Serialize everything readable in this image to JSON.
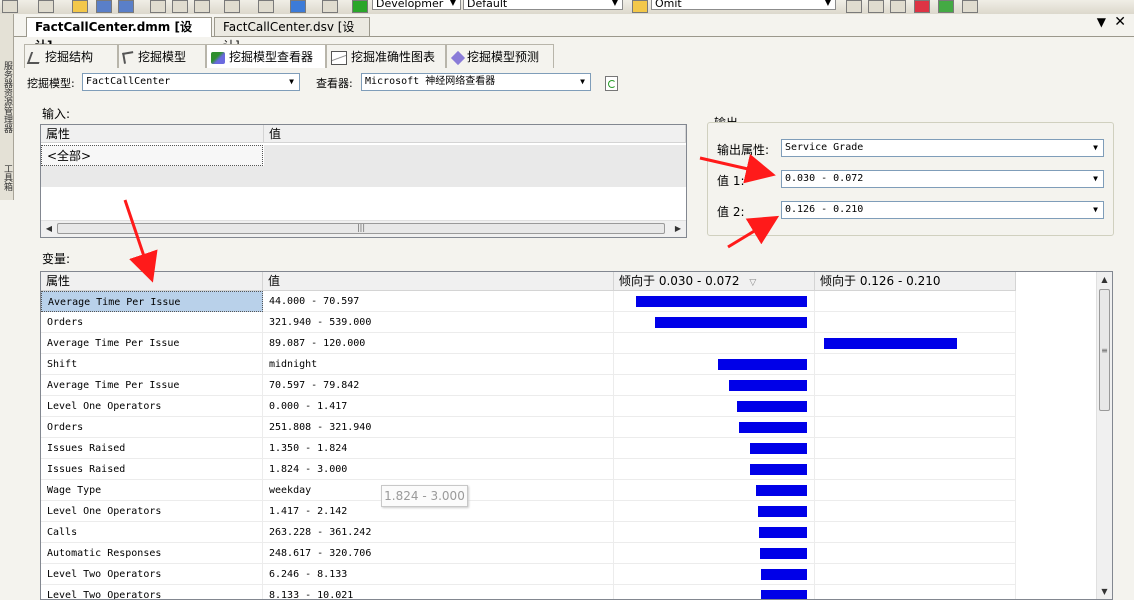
{
  "toolbar": {
    "config_value": "Developmer",
    "platform_value": "Default",
    "find_value": "Omit"
  },
  "left_strip": {
    "server_explorer": "服务器资源管理器",
    "toolbox": "工具箱"
  },
  "doc_tabs": [
    {
      "label": "FactCallCenter.dmm [设计]"
    },
    {
      "label": "FactCallCenter.dsv [设计]"
    }
  ],
  "design_tabs": [
    {
      "label": "挖掘结构"
    },
    {
      "label": "挖掘模型"
    },
    {
      "label": "挖掘模型查看器"
    },
    {
      "label": "挖掘准确性图表"
    },
    {
      "label": "挖掘模型预测"
    }
  ],
  "model_row": {
    "model_label": "挖掘模型:",
    "model_value": "FactCallCenter",
    "viewer_label": "查看器:",
    "viewer_value": "Microsoft 神经网络查看器"
  },
  "input": {
    "section_label": "输入:",
    "columns": [
      "属性",
      "值"
    ],
    "rows": [
      [
        "<全部>",
        ""
      ]
    ]
  },
  "output": {
    "group_label": "输出",
    "attr_label": "输出属性:",
    "attr_value": "Service Grade",
    "value1_label": "值 1:",
    "value1": "0.030 - 0.072",
    "value2_label": "值 2:",
    "value2": "0.126 - 0.210"
  },
  "variables": {
    "section_label": "变量:",
    "columns": [
      "属性",
      "值",
      "倾向于 0.030 - 0.072",
      "倾向于 0.126 - 0.210"
    ],
    "rows": [
      {
        "attribute": "Average Time Per Issue",
        "value": "44.000 - 70.597",
        "favors1": 0.9,
        "favors2": 0
      },
      {
        "attribute": "Orders",
        "value": "321.940 - 539.000",
        "favors1": 0.8,
        "favors2": 0
      },
      {
        "attribute": "Average Time Per Issue",
        "value": "89.087 - 120.000",
        "favors1": 0,
        "favors2": 0.7
      },
      {
        "attribute": "Shift",
        "value": "midnight",
        "favors1": 0.47,
        "favors2": 0
      },
      {
        "attribute": "Average Time Per Issue",
        "value": "70.597 - 79.842",
        "favors1": 0.41,
        "favors2": 0
      },
      {
        "attribute": "Level One Operators",
        "value": "0.000 - 1.417",
        "favors1": 0.37,
        "favors2": 0
      },
      {
        "attribute": "Orders",
        "value": "251.808 - 321.940",
        "favors1": 0.36,
        "favors2": 0
      },
      {
        "attribute": "Issues Raised",
        "value": "1.350 - 1.824",
        "favors1": 0.3,
        "favors2": 0
      },
      {
        "attribute": "Issues Raised",
        "value": "1.824 - 3.000",
        "favors1": 0.3,
        "favors2": 0
      },
      {
        "attribute": "Wage Type",
        "value": "weekday",
        "favors1": 0.27,
        "favors2": 0
      },
      {
        "attribute": "Level One Operators",
        "value": "1.417 - 2.142",
        "favors1": 0.26,
        "favors2": 0
      },
      {
        "attribute": "Calls",
        "value": "263.228 - 361.242",
        "favors1": 0.25,
        "favors2": 0
      },
      {
        "attribute": "Automatic Responses",
        "value": "248.617 - 320.706",
        "favors1": 0.245,
        "favors2": 0
      },
      {
        "attribute": "Level Two Operators",
        "value": "6.246 - 8.133",
        "favors1": 0.24,
        "favors2": 0
      },
      {
        "attribute": "Level Two Operators",
        "value": "8.133 - 10.021",
        "favors1": 0.24,
        "favors2": 0
      }
    ]
  },
  "tooltip": "1.824 - 3.000",
  "colors": {
    "bar": "#0000e8",
    "arrow": "#ff1a1a",
    "selection": "#b9d1ea"
  }
}
